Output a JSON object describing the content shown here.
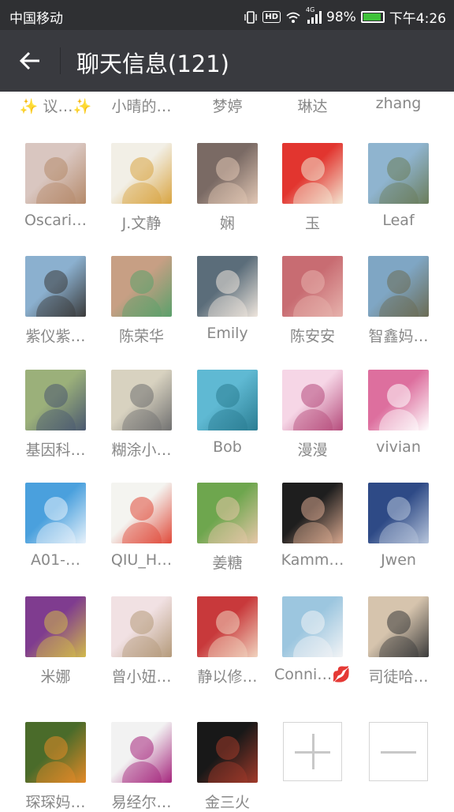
{
  "status_bar": {
    "carrier": "中国移动",
    "network": "4G",
    "hd": "HD",
    "battery": "98%",
    "time": "下午4:26"
  },
  "header": {
    "title": "聊天信息(121)",
    "back_icon": "arrow-left-icon"
  },
  "partial_row": [
    "✨ 议…✨",
    "小晴的…",
    "梦婷",
    "琳达",
    "zhang"
  ],
  "members": [
    {
      "name": "Oscari…",
      "colors": [
        "#d9c6c0",
        "#b58a6a"
      ]
    },
    {
      "name": "J.文静",
      "colors": [
        "#f2efe6",
        "#d9a441"
      ]
    },
    {
      "name": "娴",
      "colors": [
        "#7a6a64",
        "#e2c7b4"
      ]
    },
    {
      "name": "玉",
      "colors": [
        "#e2352f",
        "#f3e6d2"
      ]
    },
    {
      "name": "Leaf",
      "colors": [
        "#8fb4cf",
        "#6b7d5a"
      ]
    },
    {
      "name": "紫仪紫…",
      "colors": [
        "#8bb0cf",
        "#3a3a3a"
      ]
    },
    {
      "name": "陈荣华",
      "colors": [
        "#c79f84",
        "#5aa06b"
      ]
    },
    {
      "name": "Emily",
      "colors": [
        "#5b6d7a",
        "#efe6dd"
      ]
    },
    {
      "name": "陈安安",
      "colors": [
        "#c86c72",
        "#e7b3ad"
      ]
    },
    {
      "name": "智鑫妈…",
      "colors": [
        "#7fa6c4",
        "#6b6b53"
      ]
    },
    {
      "name": "基因科…",
      "colors": [
        "#9bb07a",
        "#4a5870"
      ]
    },
    {
      "name": "糊涂小…",
      "colors": [
        "#d8d2c0",
        "#707070"
      ]
    },
    {
      "name": "Bob",
      "colors": [
        "#5fb9d3",
        "#2a7d92"
      ]
    },
    {
      "name": "漫漫",
      "colors": [
        "#f6d6e6",
        "#b54b7b"
      ]
    },
    {
      "name": "vivian",
      "colors": [
        "#dd6f9e",
        "#ffffff"
      ]
    },
    {
      "name": "A01-…",
      "colors": [
        "#4aa0dd",
        "#e8f2fb"
      ]
    },
    {
      "name": "QIU_H…",
      "colors": [
        "#f4f4f0",
        "#e04a3a"
      ]
    },
    {
      "name": "姜糖",
      "colors": [
        "#6ea64e",
        "#e7c7a8"
      ]
    },
    {
      "name": "Kamm…",
      "colors": [
        "#1e1e1e",
        "#d8a88f"
      ]
    },
    {
      "name": "Jwen",
      "colors": [
        "#2e4a86",
        "#b8c6dc"
      ]
    },
    {
      "name": "米娜",
      "colors": [
        "#7f3c8f",
        "#d2ba4b"
      ]
    },
    {
      "name": "曾小妞…",
      "colors": [
        "#f1e1e3",
        "#b49a7a"
      ]
    },
    {
      "name": "静以修…",
      "colors": [
        "#c8393b",
        "#f1d4bf"
      ]
    },
    {
      "name": "Conni…💋",
      "colors": [
        "#9cc6df",
        "#f3f4f6"
      ]
    },
    {
      "name": "司徒哈…",
      "colors": [
        "#d6c4ad",
        "#3b3b3b"
      ]
    },
    {
      "name": "琛琛妈…",
      "colors": [
        "#4a6b2a",
        "#e58a27"
      ]
    },
    {
      "name": "易经尔…",
      "colors": [
        "#f2f2f2",
        "#a5257c"
      ]
    },
    {
      "name": "金三火",
      "colors": [
        "#181818",
        "#a23a2a"
      ]
    }
  ],
  "actions": {
    "add": "add-member-icon",
    "remove": "remove-member-icon"
  }
}
